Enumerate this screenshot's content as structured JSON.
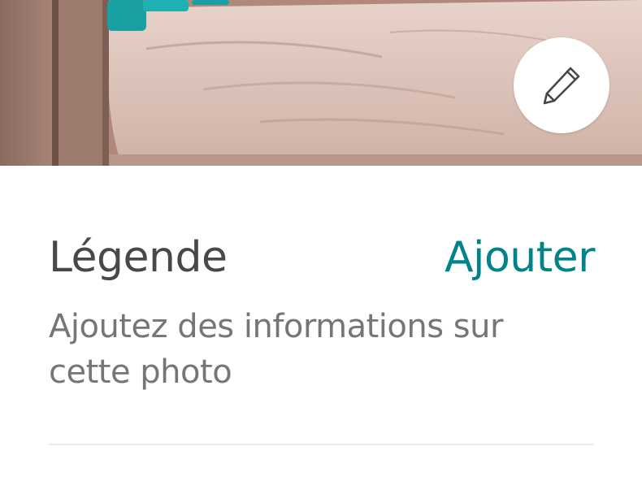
{
  "photo": {
    "description_icon": "bed-photo",
    "edit_icon": "pencil-icon"
  },
  "caption": {
    "title": "Légende",
    "action_label": "Ajouter",
    "description": "Ajoutez des informations sur cette photo"
  },
  "colors": {
    "accent": "#008489",
    "title_text": "#484848",
    "secondary_text": "#767676",
    "divider": "#ebebeb"
  }
}
